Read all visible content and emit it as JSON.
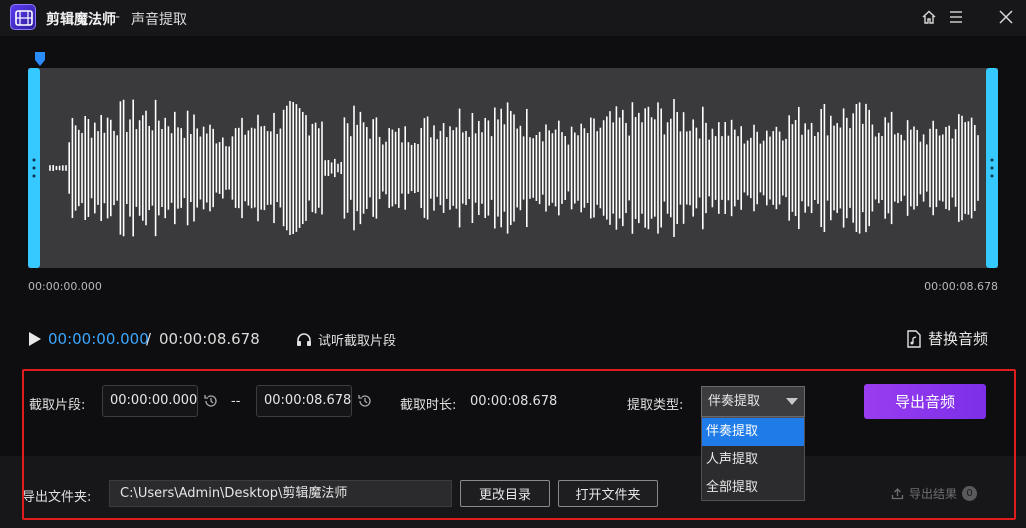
{
  "window": {
    "app_name": "剪辑魔法师",
    "separator": "-",
    "page_title": "声音提取"
  },
  "icons": {
    "home": "home-icon",
    "menu": "menu-icon",
    "close": "close-icon",
    "play": "play-icon",
    "headphones": "headphones-icon",
    "replace": "audio-file-icon",
    "reset": "reset-time-icon",
    "export_result": "upload-icon"
  },
  "colors": {
    "accent_blue": "#3ba7ff",
    "handle_cyan": "#35c9ff",
    "export_purple": "#9a3cf0",
    "highlight_red": "#e01c1c",
    "dropdown_selected": "#1e7be8"
  },
  "timeline": {
    "start_label": "00:00:00.000",
    "end_label": "00:00:08.678",
    "playhead_fraction": 0
  },
  "playback": {
    "current_time": "00:00:00.000",
    "separator": "/",
    "duration": "00:00:08.678",
    "preview_label": "试听截取片段",
    "replace_label": "替换音频"
  },
  "clip": {
    "segment_label": "截取片段:",
    "start_value": "00:00:00.000",
    "range_separator": "--",
    "end_value": "00:00:08.678",
    "length_label": "截取时长:",
    "length_value": "00:00:08.678"
  },
  "extract": {
    "type_label": "提取类型:",
    "selected": "伴奏提取",
    "options": [
      "伴奏提取",
      "人声提取",
      "全部提取"
    ]
  },
  "export": {
    "button_label": "导出音频",
    "folder_label": "导出文件夹:",
    "folder_path": "C:\\Users\\Admin\\Desktop\\剪辑魔法师",
    "change_dir_label": "更改目录",
    "open_folder_label": "打开文件夹",
    "result_label": "导出结果",
    "result_count": "0"
  }
}
